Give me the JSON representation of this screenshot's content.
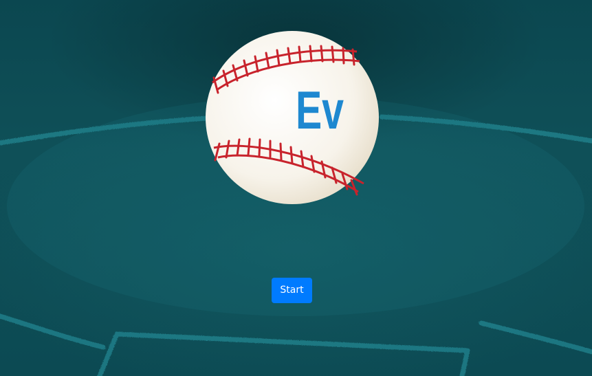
{
  "logo": {
    "text": "Ev",
    "text_color": "#1e88d0",
    "stitch_color": "#c8232c",
    "ball_color": "#f7f3ea"
  },
  "actions": {
    "start_label": "Start"
  },
  "colors": {
    "background": "#0f4e56",
    "chalk": "#2a9aa6",
    "button": "#007bff"
  }
}
